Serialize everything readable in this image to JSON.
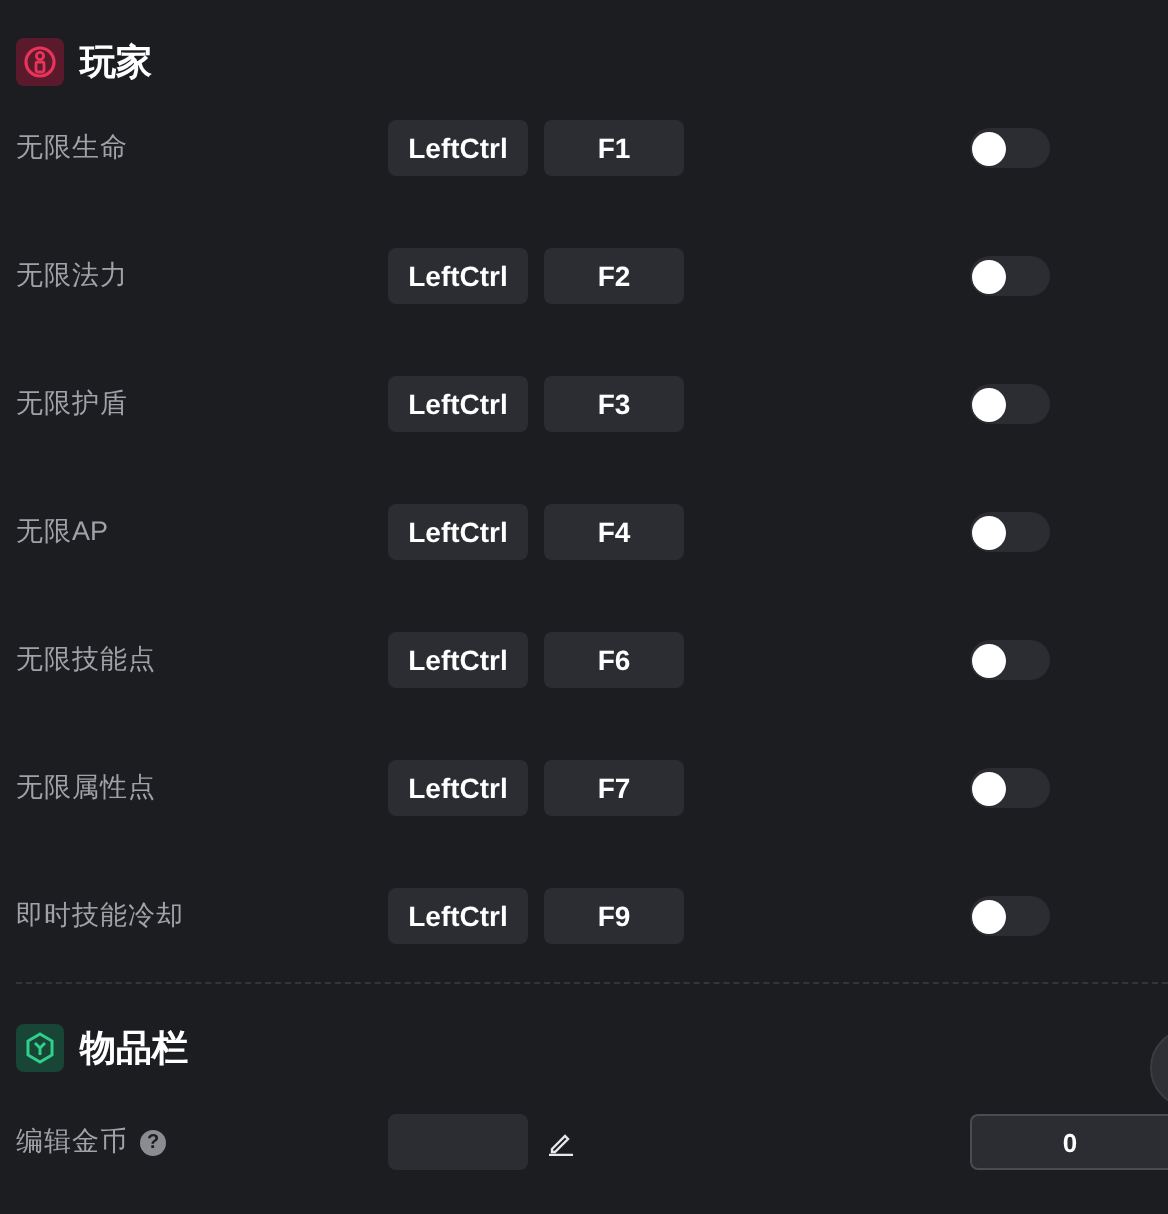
{
  "sections": [
    {
      "title": "玩家",
      "kind": "player",
      "rows": [
        {
          "kind": "hotkey",
          "label": "无限生命",
          "keys": [
            "LeftCtrl",
            "F1"
          ],
          "on": false
        },
        {
          "kind": "hotkey",
          "label": "无限法力",
          "keys": [
            "LeftCtrl",
            "F2"
          ],
          "on": false
        },
        {
          "kind": "hotkey",
          "label": "无限护盾",
          "keys": [
            "LeftCtrl",
            "F3"
          ],
          "on": false
        },
        {
          "kind": "hotkey",
          "label": "无限AP",
          "keys": [
            "LeftCtrl",
            "F4"
          ],
          "on": false
        },
        {
          "kind": "hotkey",
          "label": "无限技能点",
          "keys": [
            "LeftCtrl",
            "F6"
          ],
          "on": false
        },
        {
          "kind": "hotkey",
          "label": "无限属性点",
          "keys": [
            "LeftCtrl",
            "F7"
          ],
          "on": false
        },
        {
          "kind": "hotkey",
          "label": "即时技能冷却",
          "keys": [
            "LeftCtrl",
            "F9"
          ],
          "on": false
        }
      ]
    },
    {
      "title": "物品栏",
      "kind": "inventory",
      "rows": [
        {
          "kind": "number",
          "label": "编辑金币",
          "help": "?",
          "value": "0"
        }
      ]
    }
  ]
}
